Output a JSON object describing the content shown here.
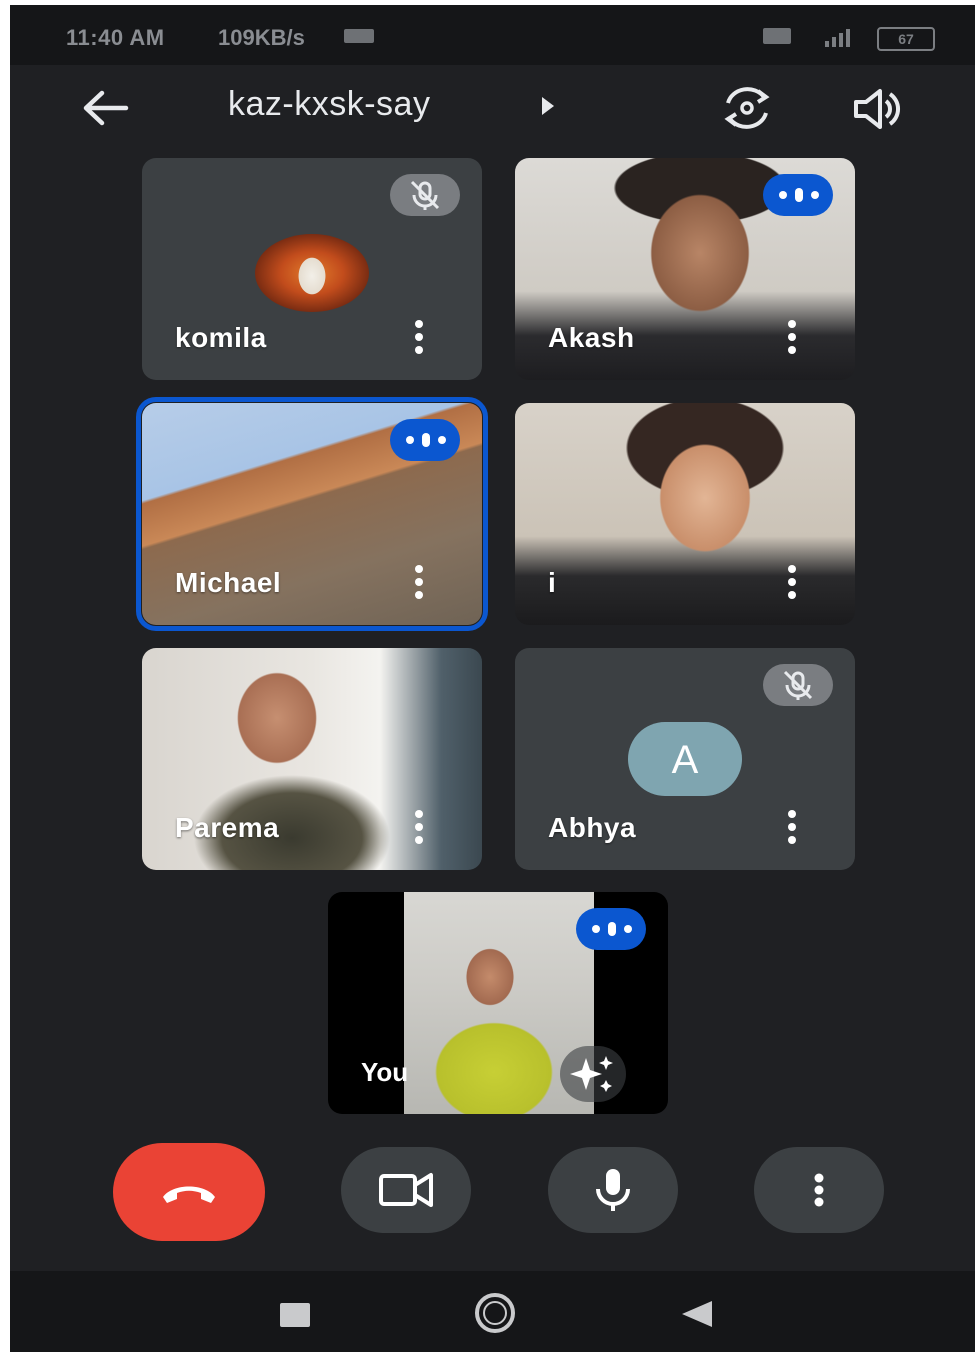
{
  "status_bar": {
    "time": "11:40 AM",
    "network_speed": "109KB/s",
    "battery": "67"
  },
  "header": {
    "meeting_code": "kaz-kxsk-say"
  },
  "participants": [
    {
      "name": "komila",
      "state": "muted"
    },
    {
      "name": "Akash",
      "state": "speaking"
    },
    {
      "name": "Michael",
      "state": "speaking"
    },
    {
      "name": "i",
      "state": "none"
    },
    {
      "name": "Parema",
      "state": "none"
    },
    {
      "name": "Abhya",
      "state": "muted",
      "avatar_letter": "A"
    }
  ],
  "self_view": {
    "name": "You",
    "state": "speaking"
  },
  "colors": {
    "hangup": "#ea4335",
    "speaking_badge": "#0b57d0",
    "tile_bg": "#3c4043",
    "selected_outline": "#0b57d0"
  },
  "icons": [
    "back-arrow-icon",
    "play-caret-icon",
    "flip-camera-icon",
    "speaker-icon",
    "mic-off-icon",
    "speaking-indicator-icon",
    "more-vert-icon",
    "sparkle-effects-icon",
    "hangup-icon",
    "video-camera-icon",
    "mic-icon",
    "recents-icon",
    "home-icon",
    "nav-back-icon"
  ]
}
